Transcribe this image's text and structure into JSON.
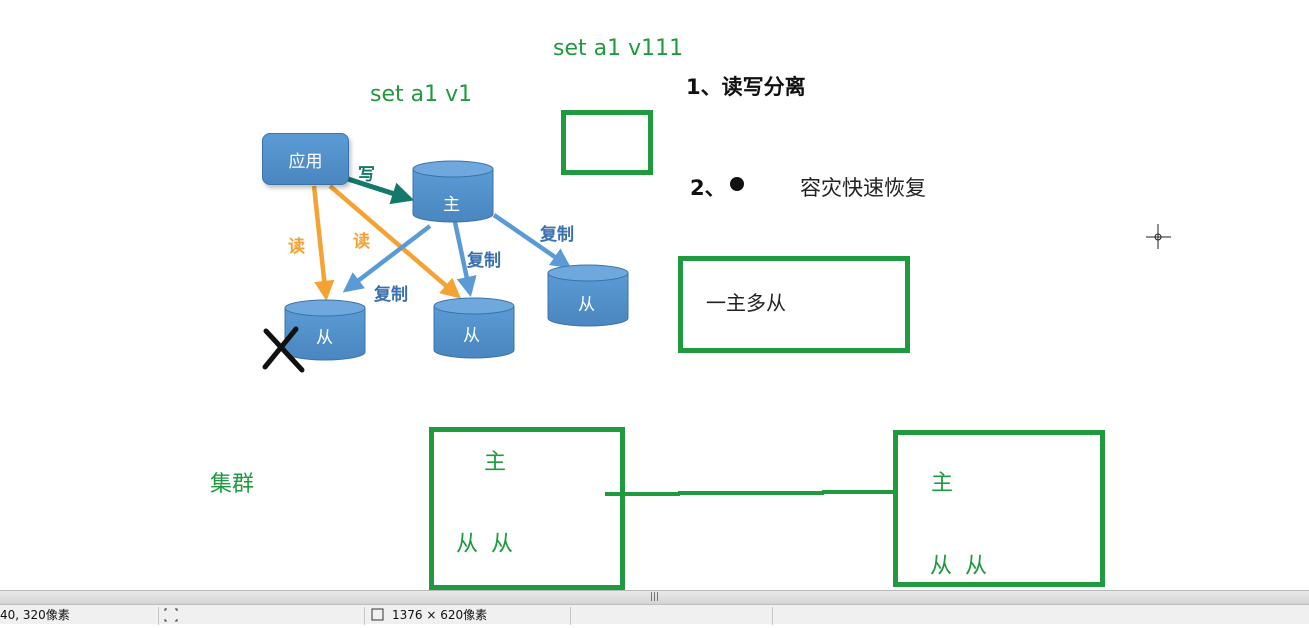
{
  "annotations": {
    "cmd_top": "set a1 v111",
    "cmd_left": "set a1 v1",
    "cluster_label": "集群"
  },
  "points": {
    "p1": "1、读写分离",
    "p2_prefix": "2、",
    "p2_text": "容灾快速恢复",
    "box_text": "一主多从"
  },
  "diagram": {
    "app": "应用",
    "master": "主",
    "slave": "从",
    "write": "写",
    "read": "读",
    "copy": "复制"
  },
  "cluster": {
    "left": {
      "master": "主",
      "slaves": "从 从"
    },
    "right": {
      "master": "主",
      "slaves": "从 从"
    }
  },
  "statusbar": {
    "cell1": "40, 320像素",
    "cell3": "1376 × 620像素"
  }
}
